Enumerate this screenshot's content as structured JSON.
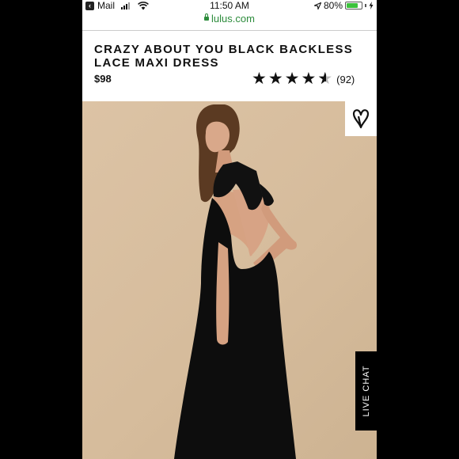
{
  "status_bar": {
    "back_app": "Mail",
    "time": "11:50 AM",
    "battery": "80%",
    "battery_level": 0.8
  },
  "url_bar": {
    "domain": "lulus.com"
  },
  "product": {
    "title_line1": "CRAZY ABOUT YOU BLACK BACKLESS",
    "title_line2": "LACE MAXI DRESS",
    "price": "$98",
    "rating": 4.5,
    "review_count": "(92)"
  },
  "live_chat": {
    "label": "LIVE CHAT"
  },
  "colors": {
    "url_green": "#2d8c3c",
    "photo_bg": "#d8bf9f",
    "dress": "#0d0d0d"
  },
  "icons": [
    "back-arrow-icon",
    "signal-icon",
    "wifi-icon",
    "lock-icon",
    "location-arrow-icon",
    "battery-icon",
    "charging-icon",
    "star-icon",
    "heart-icon"
  ]
}
